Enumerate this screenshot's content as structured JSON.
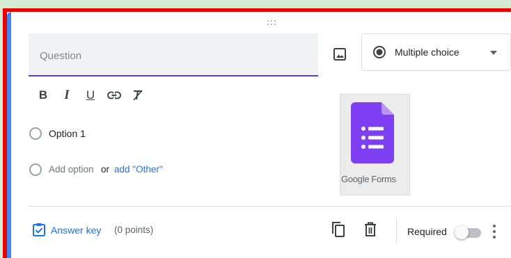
{
  "question": {
    "placeholder": "Question"
  },
  "type_select": {
    "selected": "Multiple choice",
    "icon": "radio-button-checked-icon"
  },
  "toolbar": {
    "bold_label": "B",
    "italic_label": "I",
    "underline_label": "U",
    "icons": [
      "bold-icon",
      "italic-icon",
      "underline-icon",
      "link-icon",
      "clear-format-icon"
    ]
  },
  "options": [
    {
      "label": "Option 1"
    }
  ],
  "add_option": {
    "label": "Add option",
    "or_text": "or",
    "other_link": "add \"Other\""
  },
  "logo": {
    "text": "Google Forms",
    "color": "#7e3ff2"
  },
  "footer": {
    "answer_key_label": "Answer key",
    "points_label": "(0 points)",
    "required_label": "Required",
    "required_on": false
  },
  "colors": {
    "accent_bar": "#4285f4",
    "question_underline": "#673ab7",
    "link_blue": "#1a73e8",
    "highlight_border": "#e80000",
    "page_background": "#d5ead0"
  }
}
